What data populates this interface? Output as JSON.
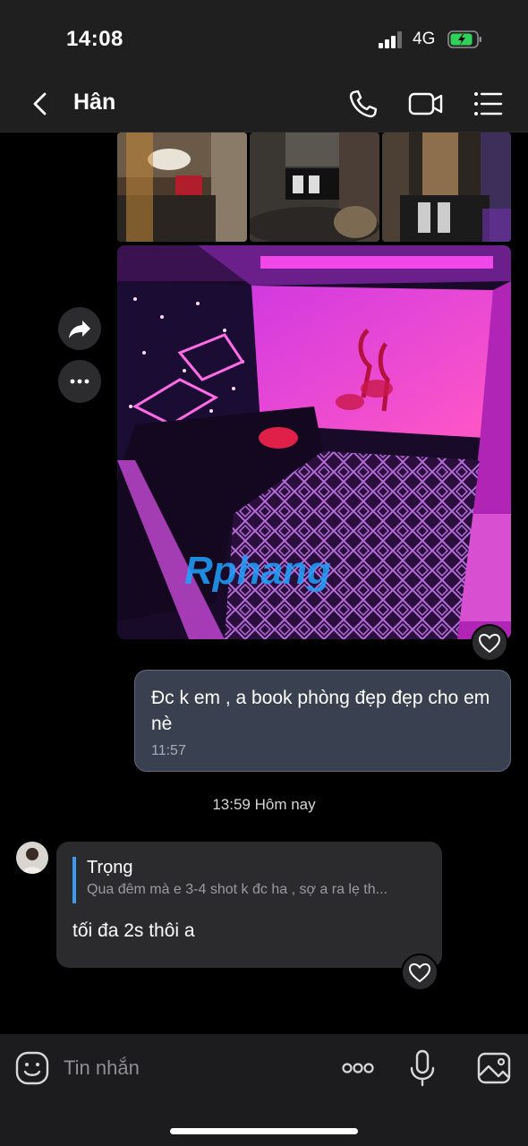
{
  "status_bar": {
    "time": "14:08",
    "network": "4G",
    "battery_charging": true,
    "battery_color": "#30d158"
  },
  "header": {
    "back_icon": "chevron-left-icon",
    "contact_name": "Hân",
    "call_icon": "phone-icon",
    "video_icon": "video-camera-icon",
    "menu_icon": "list-icon"
  },
  "conversation": {
    "photo_actions": {
      "share_icon": "share-arrow-icon",
      "more_icon": "ellipsis-icon"
    },
    "photo_watermark": "Rphang",
    "outgoing_message": {
      "text": "Đc k em , a book phòng đẹp đẹp cho em nè",
      "time": "11:57"
    },
    "day_separator": "13:59 Hôm nay",
    "incoming_message": {
      "quote_author": "Trọng",
      "quote_text": "Qua đêm mà e 3-4 shot k đc ha , sợ a ra lẹ th...",
      "text": "tối đa 2s thôi a"
    }
  },
  "input_bar": {
    "emoji_icon": "emoji-icon",
    "placeholder": "Tin nhắn",
    "more_icon": "ellipsis-icon",
    "mic_icon": "microphone-icon",
    "gallery_icon": "image-icon"
  },
  "colors": {
    "accent_blue": "#3b9bf2",
    "outgoing_bubble": "#394150",
    "incoming_bubble": "#2b2b2e"
  }
}
